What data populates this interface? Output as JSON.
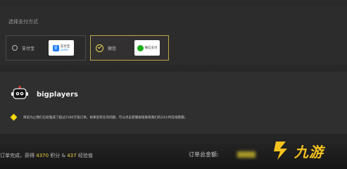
{
  "payment": {
    "title": "选择支付方式",
    "options": [
      {
        "label": "支付宝",
        "logo_text": "支付宝",
        "logo_sub": "ALIPAY",
        "selected": false
      },
      {
        "label": "微信",
        "logo_text": "微信支付",
        "selected": true
      }
    ]
  },
  "account": {
    "username": "bigplayers",
    "note": "目前为止我们已处理成了超过2180万笔订单。如果您有任何问题，可以点击客服按钮联系我们的24小时在线客服。"
  },
  "footer": {
    "left_prefix": "订单完成，获得",
    "points": "4370",
    "points_label": "积分 &",
    "exp": "437",
    "exp_label": "经验值",
    "total_label": "订单总金额:"
  },
  "watermark": {
    "text": "九游"
  },
  "colors": {
    "accent": "#e8cf3a",
    "selected_border": "#b9a64a",
    "alipay_blue": "#1677ff",
    "wechat_green": "#1aad19"
  }
}
